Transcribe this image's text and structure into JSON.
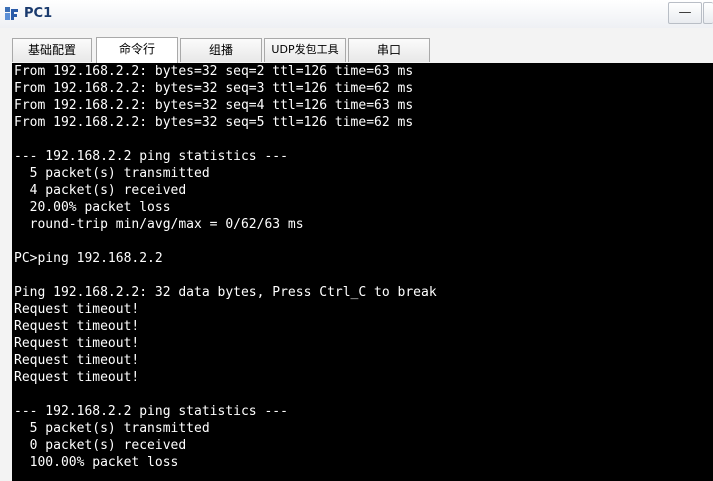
{
  "window": {
    "title": "PC1",
    "minimize_glyph": "—",
    "accent_color": "#1a3a6e"
  },
  "tabs": [
    {
      "label": "基础配置",
      "active": false
    },
    {
      "label": "命令行",
      "active": true
    },
    {
      "label": "组播",
      "active": false
    },
    {
      "label": "UDP发包工具",
      "active": false
    },
    {
      "label": "串口",
      "active": false
    }
  ],
  "terminal": {
    "background": "#000000",
    "text_color": "#ffffff",
    "lines": [
      "From 192.168.2.2: bytes=32 seq=2 ttl=126 time=63 ms",
      "From 192.168.2.2: bytes=32 seq=3 ttl=126 time=62 ms",
      "From 192.168.2.2: bytes=32 seq=4 ttl=126 time=63 ms",
      "From 192.168.2.2: bytes=32 seq=5 ttl=126 time=62 ms",
      "",
      "--- 192.168.2.2 ping statistics ---",
      "  5 packet(s) transmitted",
      "  4 packet(s) received",
      "  20.00% packet loss",
      "  round-trip min/avg/max = 0/62/63 ms",
      "",
      "PC>ping 192.168.2.2",
      "",
      "Ping 192.168.2.2: 32 data bytes, Press Ctrl_C to break",
      "Request timeout!",
      "Request timeout!",
      "Request timeout!",
      "Request timeout!",
      "Request timeout!",
      "",
      "--- 192.168.2.2 ping statistics ---",
      "  5 packet(s) transmitted",
      "  0 packet(s) received",
      "  100.00% packet loss"
    ]
  }
}
